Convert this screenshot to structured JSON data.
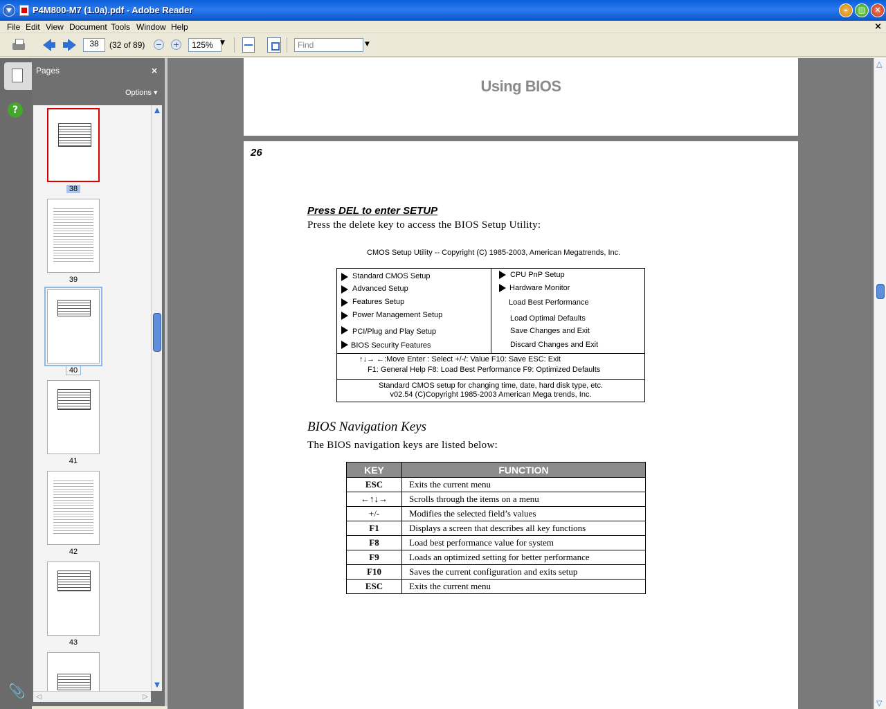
{
  "window": {
    "title": "P4M800-M7 (1.0a).pdf - Adobe Reader"
  },
  "menubar": {
    "items": [
      "File",
      "Edit",
      "View",
      "Document",
      "Tools",
      "Window",
      "Help"
    ],
    "close": "×"
  },
  "toolbar": {
    "current_page": "38",
    "page_count": "(32 of 89)",
    "zoom": "125%",
    "find_placeholder": "Find"
  },
  "pages_panel": {
    "title": "Pages",
    "close": "×",
    "options": "Options ▾",
    "thumbnails": [
      {
        "label": "38",
        "state": "selected"
      },
      {
        "label": "39",
        "state": "normal"
      },
      {
        "label": "40",
        "state": "current-view"
      },
      {
        "label": "41",
        "state": "normal"
      },
      {
        "label": "42",
        "state": "normal"
      },
      {
        "label": "43",
        "state": "normal"
      }
    ]
  },
  "document": {
    "header": "Using BIOS",
    "page_number": "26",
    "section_title": "Press DEL to enter SETUP",
    "section_text": "Press the delete key to access the BIOS Setup Utility:",
    "cmos_caption": "CMOS Setup Utility -- Copyright (C) 1985-2003, American Megatrends, Inc.",
    "cmos_left": [
      "Standard CMOS Setup",
      "Advanced Setup",
      "Features Setup",
      "Power Management Setup",
      "PCI/Plug and Play Setup",
      "BIOS Security Features"
    ],
    "cmos_right": [
      "CPU PnP Setup",
      "Hardware Monitor",
      "Load Best Performance",
      "Load Optimal Defaults",
      "Save Changes and Exit",
      "Discard Changes and Exit"
    ],
    "keys_line1": "↑↓→ ←:Move   Enter : Select    +/-/: Value    F10: Save   ESC: Exit",
    "keys_line2": "F1: General Help    F8: Load Best Performance    F9: Optimized Defaults",
    "footer_line1": "Standard CMOS setup for changing time, date, hard disk type, etc.",
    "footer_line2": "v02.54  (C)Copyright  1985-2003 American Mega trends, Inc.",
    "nav_title": "BIOS Navigation Keys",
    "nav_text": "The BIOS navigation keys are listed below:",
    "table": {
      "headers": [
        "KEY",
        "FUNCTION"
      ],
      "rows": [
        [
          "ESC",
          "Exits the current menu"
        ],
        [
          "←↑↓→",
          "Scrolls through the items on a menu"
        ],
        [
          "+/-",
          "Modifies the selected field’s values"
        ],
        [
          "F1",
          "Displays a screen that describes all key functions"
        ],
        [
          "F8",
          "Load best performance value for system"
        ],
        [
          "F9",
          "Loads an optimized setting for better performance"
        ],
        [
          "F10",
          "Saves the current configuration and exits setup"
        ],
        [
          "ESC",
          "Exits the current menu"
        ]
      ]
    }
  }
}
